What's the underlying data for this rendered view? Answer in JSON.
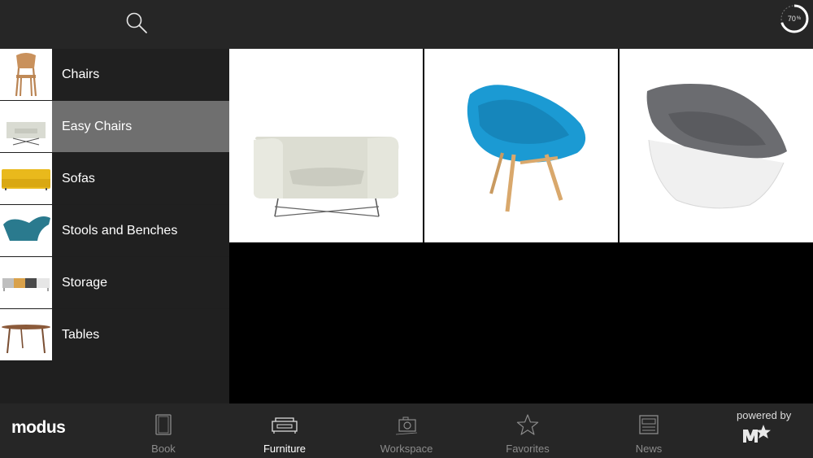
{
  "header": {
    "search_icon": "search-icon",
    "download_progress": {
      "value_percent": 70,
      "value_text": "70",
      "unit": "%"
    }
  },
  "sidebar": {
    "selected_index": 1,
    "items": [
      {
        "label": "Chairs",
        "thumb": "wooden-chair"
      },
      {
        "label": "Easy Chairs",
        "thumb": "grey-armchair"
      },
      {
        "label": "Sofas",
        "thumb": "yellow-sofa"
      },
      {
        "label": "Stools and Benches",
        "thumb": "teal-stool"
      },
      {
        "label": "Storage",
        "thumb": "sideboard"
      },
      {
        "label": "Tables",
        "thumb": "round-table"
      }
    ]
  },
  "products": [
    {
      "image": "light-grey-lounge-chair"
    },
    {
      "image": "blue-shell-chair-wooden-legs"
    },
    {
      "image": "grey-egg-chair-white-base"
    }
  ],
  "bottom_bar": {
    "brand": "modus",
    "tabs": [
      {
        "label": "Book",
        "icon": "book-icon"
      },
      {
        "label": "Furniture",
        "icon": "sofa-icon",
        "active": true
      },
      {
        "label": "Workspace",
        "icon": "camera-icon"
      },
      {
        "label": "Favorites",
        "icon": "star-icon"
      },
      {
        "label": "News",
        "icon": "newspaper-icon"
      }
    ],
    "powered_by": "powered by",
    "powered_logo": "M★"
  },
  "colors": {
    "bar_bg": "#262626",
    "sidebar_bg": "#202020",
    "selected_bg": "#6f6f6f",
    "inactive_tab_text": "#8c8c8c",
    "active_tab_text": "#ffffff",
    "blue_chair": "#1b9ad3"
  }
}
